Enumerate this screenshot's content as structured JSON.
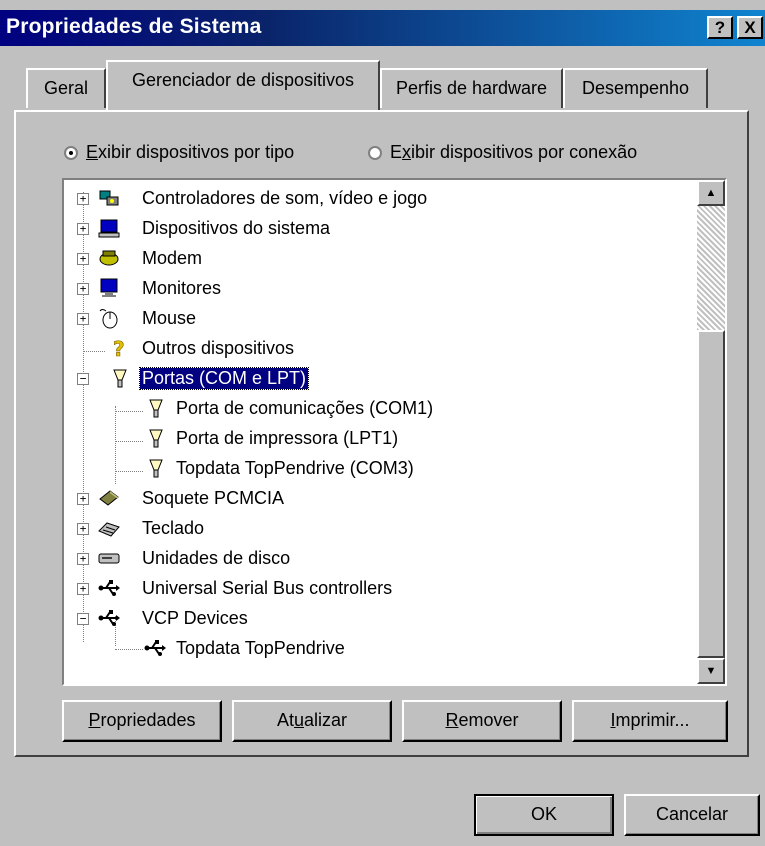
{
  "window": {
    "title": "Propriedades de Sistema",
    "help_glyph": "?",
    "close_glyph": "X"
  },
  "tabs": [
    {
      "label": "Geral",
      "active": false
    },
    {
      "label": "Gerenciador de dispositivos",
      "active": true
    },
    {
      "label": "Perfis de hardware",
      "active": false
    },
    {
      "label": "Desempenho",
      "active": false
    }
  ],
  "view_options": {
    "by_type": {
      "label_mnemonic": "E",
      "label_rest": "xibir dispositivos por tipo",
      "checked": true
    },
    "by_connection": {
      "label_pre": "E",
      "label_mnemonic": "x",
      "label_rest": "ibir dispositivos por conexão",
      "checked": false
    }
  },
  "device_tree": [
    {
      "label": "Controladores de som, vídeo e jogo",
      "icon": "sound-video-icon",
      "expanded": false,
      "level": 0
    },
    {
      "label": "Dispositivos do sistema",
      "icon": "system-device-icon",
      "expanded": false,
      "level": 0
    },
    {
      "label": "Modem",
      "icon": "modem-icon",
      "expanded": false,
      "level": 0
    },
    {
      "label": "Monitores",
      "icon": "monitor-icon",
      "expanded": false,
      "level": 0
    },
    {
      "label": "Mouse",
      "icon": "mouse-icon",
      "expanded": false,
      "level": 0
    },
    {
      "label": "Outros dispositivos",
      "icon": "question-mark-icon",
      "expanded": null,
      "level": 0
    },
    {
      "label": "Portas (COM e LPT)",
      "icon": "port-connector-icon",
      "expanded": true,
      "level": 0,
      "selected": true
    },
    {
      "label": "Porta de comunicações (COM1)",
      "icon": "port-connector-icon",
      "level": 1
    },
    {
      "label": "Porta de impressora (LPT1)",
      "icon": "port-connector-icon",
      "level": 1
    },
    {
      "label": "Topdata TopPendrive (COM3)",
      "icon": "port-connector-icon",
      "level": 1
    },
    {
      "label": "Soquete PCMCIA",
      "icon": "pcmcia-card-icon",
      "expanded": false,
      "level": 0
    },
    {
      "label": "Teclado",
      "icon": "keyboard-icon",
      "expanded": false,
      "level": 0
    },
    {
      "label": "Unidades de disco",
      "icon": "disk-drive-icon",
      "expanded": false,
      "level": 0
    },
    {
      "label": "Universal Serial Bus controllers",
      "icon": "usb-icon",
      "expanded": false,
      "level": 0
    },
    {
      "label": "VCP Devices",
      "icon": "usb-icon",
      "expanded": true,
      "level": 0
    },
    {
      "label": "Topdata TopPendrive",
      "icon": "usb-icon",
      "level": 1
    }
  ],
  "panel_buttons": {
    "properties": {
      "mnemonic": "P",
      "rest": "ropriedades"
    },
    "refresh": {
      "pre": "At",
      "mnemonic": "u",
      "rest": "alizar"
    },
    "remove": {
      "mnemonic": "R",
      "rest": "emover"
    },
    "print": {
      "mnemonic": "I",
      "rest": "mprimir..."
    }
  },
  "dialog_buttons": {
    "ok": "OK",
    "cancel": "Cancelar"
  },
  "colors": {
    "title_start": "#000080",
    "title_end": "#1084d0",
    "face": "#c0c0c0",
    "selection": "#000080"
  }
}
